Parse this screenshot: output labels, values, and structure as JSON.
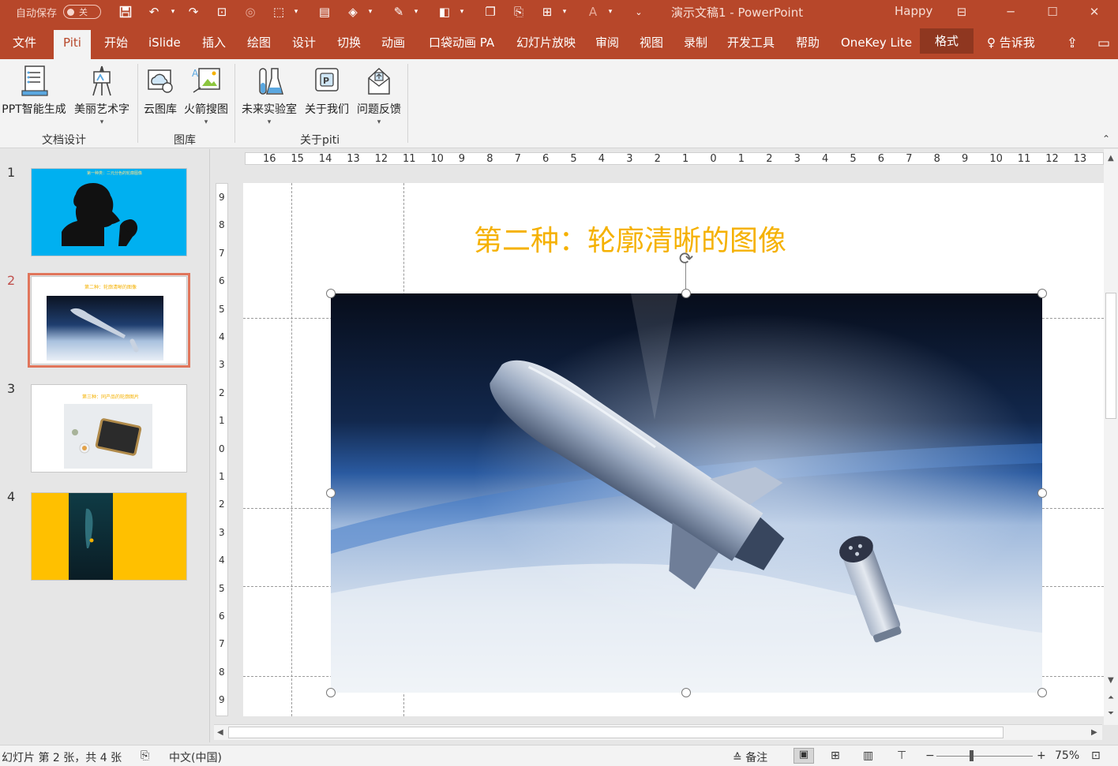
{
  "qat": {
    "autosave_label": "自动保存",
    "autosave_state": "关"
  },
  "window": {
    "title": "演示文稿1 - PowerPoint",
    "user": "Happy"
  },
  "tabs": [
    "文件",
    "Piti",
    "开始",
    "iSlide",
    "插入",
    "绘图",
    "设计",
    "切换",
    "动画",
    "口袋动画 PA",
    "幻灯片放映",
    "审阅",
    "视图",
    "录制",
    "开发工具",
    "帮助",
    "OneKey Lite",
    "格式"
  ],
  "active_tab": "Piti",
  "tell_me": "告诉我",
  "ribbon": {
    "buttons": [
      "PPT智能生成",
      "美丽艺术字",
      "云图库",
      "火箭搜图",
      "未来实验室",
      "关于我们",
      "问题反馈"
    ],
    "groups": [
      "文档设计",
      "图库",
      "关于piti"
    ]
  },
  "thumbnails": [
    {
      "num": "1",
      "caption": "第一种类：二元分色的轮廓图像"
    },
    {
      "num": "2",
      "caption": "第二种：轮廓清晰的图像"
    },
    {
      "num": "3",
      "caption": "第三种：同产品的轮廓图片"
    },
    {
      "num": "4",
      "caption": ""
    }
  ],
  "active_slide": 2,
  "rulers": {
    "h": [
      "16",
      "15",
      "14",
      "13",
      "12",
      "11",
      "10",
      "9",
      "8",
      "7",
      "6",
      "5",
      "4",
      "3",
      "2",
      "1",
      "0",
      "1",
      "2",
      "3",
      "4",
      "5",
      "6",
      "7",
      "8",
      "9",
      "10",
      "11",
      "12",
      "13"
    ],
    "v": [
      "9",
      "8",
      "7",
      "6",
      "5",
      "4",
      "3",
      "2",
      "1",
      "0",
      "1",
      "2",
      "3",
      "4",
      "5",
      "6",
      "7",
      "8",
      "9"
    ]
  },
  "slide": {
    "title": "第二种：轮廓清晰的图像"
  },
  "status": {
    "slide_info": "幻灯片 第 2 张，共 4 张",
    "language": "中文(中国)",
    "notes": "备注",
    "zoom": "75%"
  },
  "colors": {
    "accent": "#b7472a",
    "title_color": "#f5b100",
    "slide1_bg": "#00b0f0",
    "slide4_bg": "#ffc000"
  }
}
